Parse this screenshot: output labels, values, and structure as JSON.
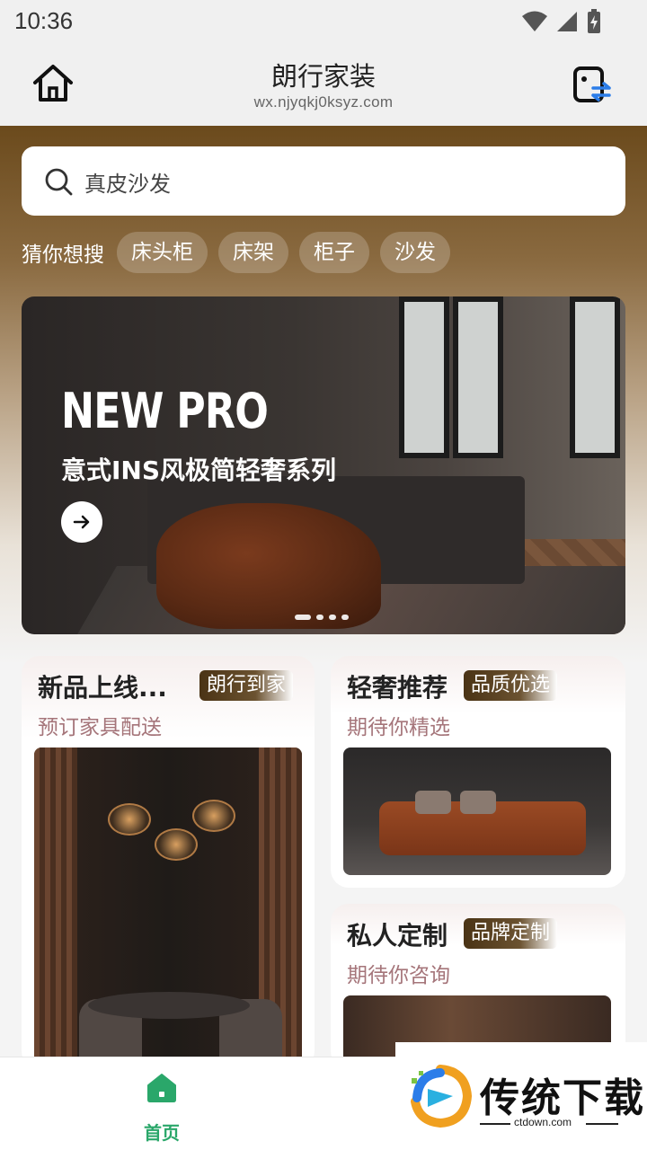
{
  "status_bar": {
    "time": "10:36"
  },
  "header": {
    "title": "朗行家装",
    "url": "wx.njyqkj0ksyz.com"
  },
  "search": {
    "placeholder": "真皮沙发"
  },
  "hot_search": {
    "label": "猜你想搜",
    "tags": [
      "床头柜",
      "床架",
      "柜子",
      "沙发"
    ]
  },
  "banner": {
    "headline": "NEW PRO",
    "subline": "意式INS风极简轻奢系列",
    "slide_count": 4,
    "active_slide": 1
  },
  "cards": [
    {
      "title": "新品上线...",
      "badge": "朗行到家",
      "subtitle": "预订家具配送"
    },
    {
      "title": "轻奢推荐",
      "badge": "品质优选",
      "subtitle": "期待你精选"
    },
    {
      "title": "私人定制",
      "badge": "品牌定制",
      "subtitle": "期待你咨询"
    }
  ],
  "tabbar": {
    "home_label": "首页"
  },
  "watermark": {
    "text": "传统下载",
    "url": "ctdown.com"
  },
  "colors": {
    "accent_green": "#2aa76a",
    "badge_brown": "#4a3315",
    "subtitle_rose": "#a5757a"
  }
}
